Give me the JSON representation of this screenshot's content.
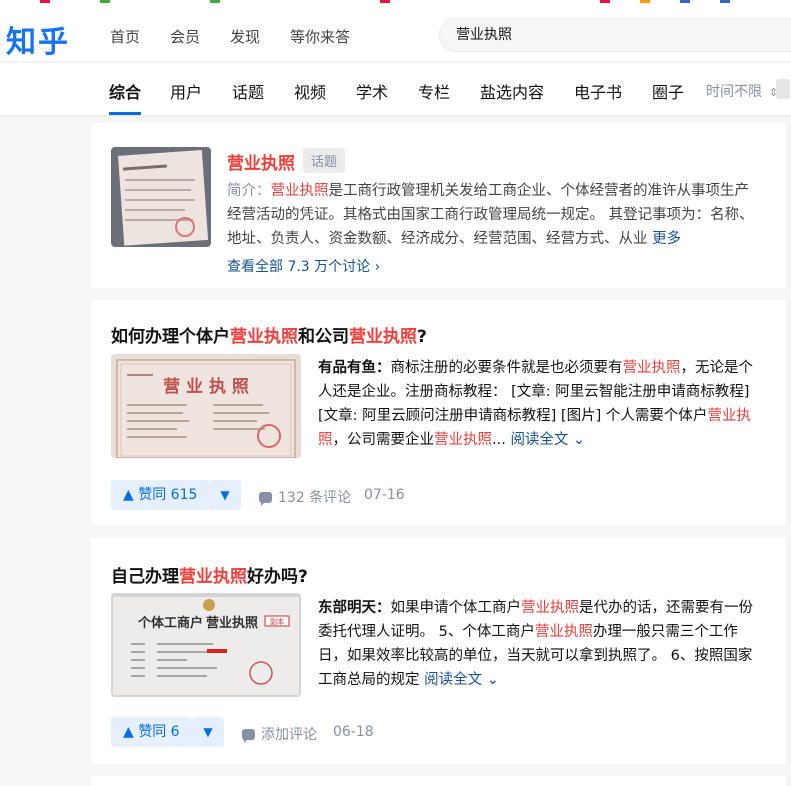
{
  "brand": {
    "logo": "知乎",
    "color": "#1772f6"
  },
  "nav": [
    "首页",
    "会员",
    "发现",
    "等你来答"
  ],
  "search": {
    "value": "营业执照"
  },
  "tabs": [
    "综合",
    "用户",
    "话题",
    "视频",
    "学术",
    "专栏",
    "盐选内容",
    "电子书",
    "圈子"
  ],
  "active_tab": "综合",
  "time_filter": "时间不限",
  "topic": {
    "title": "营业执照",
    "badge": "话题",
    "desc_prefix": "简介：",
    "desc_hl": "营业执照",
    "desc_rest": "是工商行政管理机关发给工商企业、个体经营者的准许从事项生产经营活动的凭证。其格式由国家工商行政管理局统一规定。 其登记事项为：名称、地址、负责人、资金数额、经济成分、经营范围、经营方式、从业",
    "more": "更多",
    "view_all": "查看全部 7.3 万个讨论"
  },
  "answers": [
    {
      "title_parts": [
        {
          "t": "如何办理个体户",
          "hl": false
        },
        {
          "t": "营业执照",
          "hl": true
        },
        {
          "t": "和公司",
          "hl": false
        },
        {
          "t": "营业执照",
          "hl": true
        },
        {
          "t": "?",
          "hl": false
        }
      ],
      "author": "有品有鱼：",
      "excerpt_parts": [
        {
          "t": "商标注册的必要条件就是也必须要有",
          "hl": false
        },
        {
          "t": "营业执照",
          "hl": true
        },
        {
          "t": "，无论是个人还是企业。注册商标教程： [文章: 阿里云智能注册申请商标教程] [文章: 阿里云顾问注册申请商标教程] [图片] 个人需要个体户",
          "hl": false
        },
        {
          "t": "营业执照",
          "hl": true
        },
        {
          "t": "，公司需要企业",
          "hl": false
        },
        {
          "t": "营业执照",
          "hl": true
        },
        {
          "t": "...",
          "hl": false
        }
      ],
      "read_all": "阅读全文",
      "vote_label": "赞同 615",
      "comment_label": "132 条评论",
      "date": "07-16"
    },
    {
      "title_parts": [
        {
          "t": "自己办理",
          "hl": false
        },
        {
          "t": "营业执照",
          "hl": true
        },
        {
          "t": "好办吗?",
          "hl": false
        }
      ],
      "author": "东部明天：",
      "excerpt_parts": [
        {
          "t": "如果申请个体工商户",
          "hl": false
        },
        {
          "t": "营业执照",
          "hl": true
        },
        {
          "t": "是代办的话，还需要有一份委托代理人证明。 5、个体工商户",
          "hl": false
        },
        {
          "t": "营业执照",
          "hl": true
        },
        {
          "t": "办理一般只需三个工作日，如果效率比较高的单位，当天就可以拿到执照了。 6、按照国家工商总局的规定",
          "hl": false
        }
      ],
      "read_all": "阅读全文",
      "vote_label": "赞同 6",
      "comment_label": "添加评论",
      "date": "06-18"
    }
  ],
  "img_text": {
    "a1": "营 业 执 照",
    "a2_prefix": "个体工商户",
    "a2_main": "营业执照",
    "stamp": "副本"
  },
  "colors": {
    "accent": "#056de8",
    "highlight": "#f1403c",
    "link": "#175199"
  }
}
